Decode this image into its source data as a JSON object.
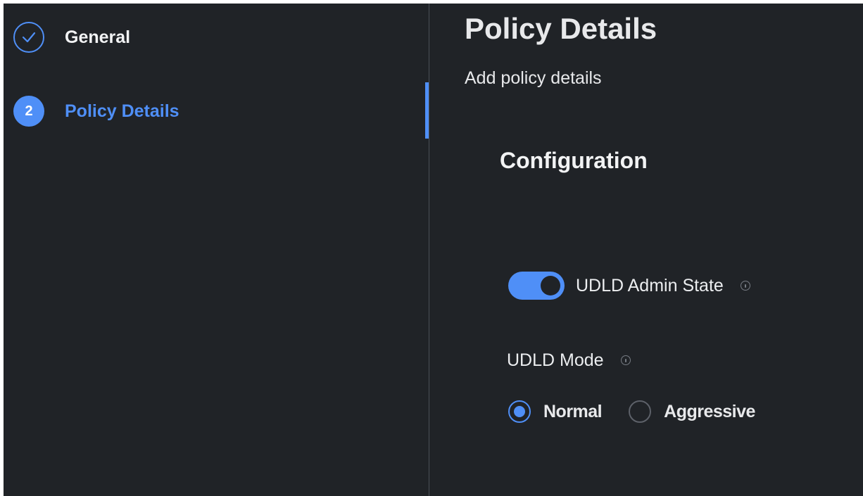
{
  "wizard": {
    "steps": [
      {
        "label": "General",
        "status": "completed",
        "icon": "check-circle-icon"
      },
      {
        "number": "2",
        "label": "Policy Details",
        "status": "current"
      }
    ]
  },
  "main": {
    "title": "Policy Details",
    "subtitle": "Add policy details",
    "section_title": "Configuration",
    "admin_state": {
      "label": "UDLD Admin State",
      "enabled": true,
      "info_icon": "info-icon"
    },
    "mode": {
      "label": "UDLD Mode",
      "info_icon": "info-icon",
      "options": [
        {
          "label": "Normal",
          "selected": true
        },
        {
          "label": "Aggressive",
          "selected": false
        }
      ]
    }
  },
  "colors": {
    "background": "#202327",
    "accent": "#4f8ff7",
    "text": "#e8e9eb",
    "divider": "#4a4e55"
  }
}
